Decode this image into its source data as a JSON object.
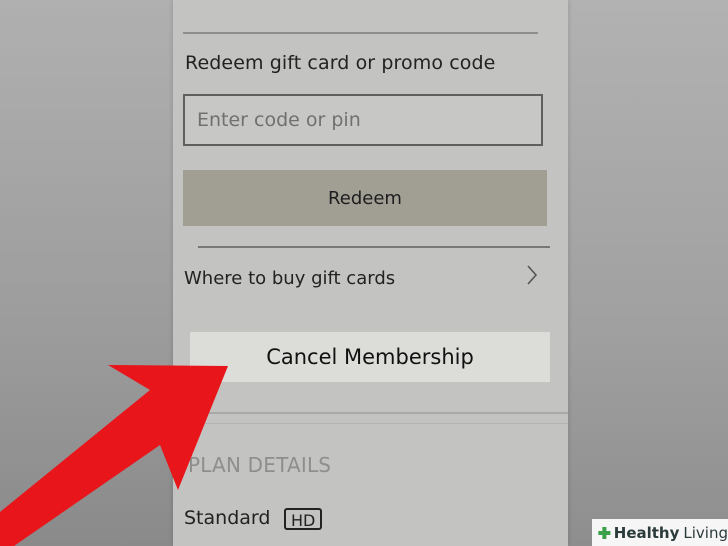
{
  "redeem": {
    "title": "Redeem gift card or promo code",
    "input_placeholder": "Enter code or pin",
    "button_label": "Redeem"
  },
  "gift_cards": {
    "label": "Where to buy gift cards",
    "chevron_icon": "chevron-right-icon"
  },
  "membership": {
    "cancel_label": "Cancel Membership"
  },
  "plan": {
    "section_title": "PLAN DETAILS",
    "plan_name": "Standard",
    "quality_badge": "HD"
  },
  "annotation": {
    "arrow_icon": "red-arrow-icon",
    "arrow_color": "#e8161b"
  },
  "watermark": {
    "brand": "Healthy",
    "sub": "Living",
    "logo_icon": "green-cross-icon",
    "logo_color": "#3aa14a"
  }
}
